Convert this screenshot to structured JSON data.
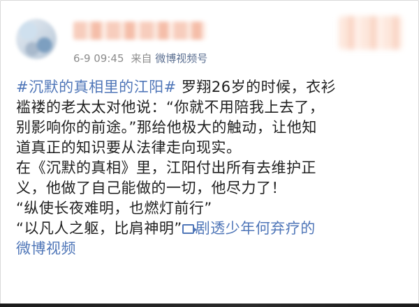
{
  "post": {
    "author_name": "",
    "meta": {
      "time": "6-9 09:45",
      "from_label": "来自",
      "source": "微博视频号"
    },
    "lines": [
      {
        "hashtag": "#沉默的真相里的江阳#",
        "text": " 罗翔26岁的时候，衣衫"
      },
      {
        "text": "褴褛的老太太对他说：“你就不用陪我上去了，"
      },
      {
        "text": "别影响你的前途。”那给他极大的触动，让他知"
      },
      {
        "text": "道真正的知识要从法律走向现实。"
      },
      {
        "text": "在《沉默的真相》里，江阳付出所有去维护正"
      },
      {
        "text": "义，他做了自己能做的一切，他尽力了！"
      },
      {
        "text": "“纵使长夜难明，也燃灯前行”"
      },
      {
        "text": "“以凡人之躯，比肩神明”",
        "link": "剧透少年何弃疗的"
      },
      {
        "link": "微博视频"
      }
    ],
    "link_icon": "video-link-icon"
  },
  "colors": {
    "link": "#4f76b8",
    "meta": "#8c8c8c",
    "text": "#202020"
  }
}
